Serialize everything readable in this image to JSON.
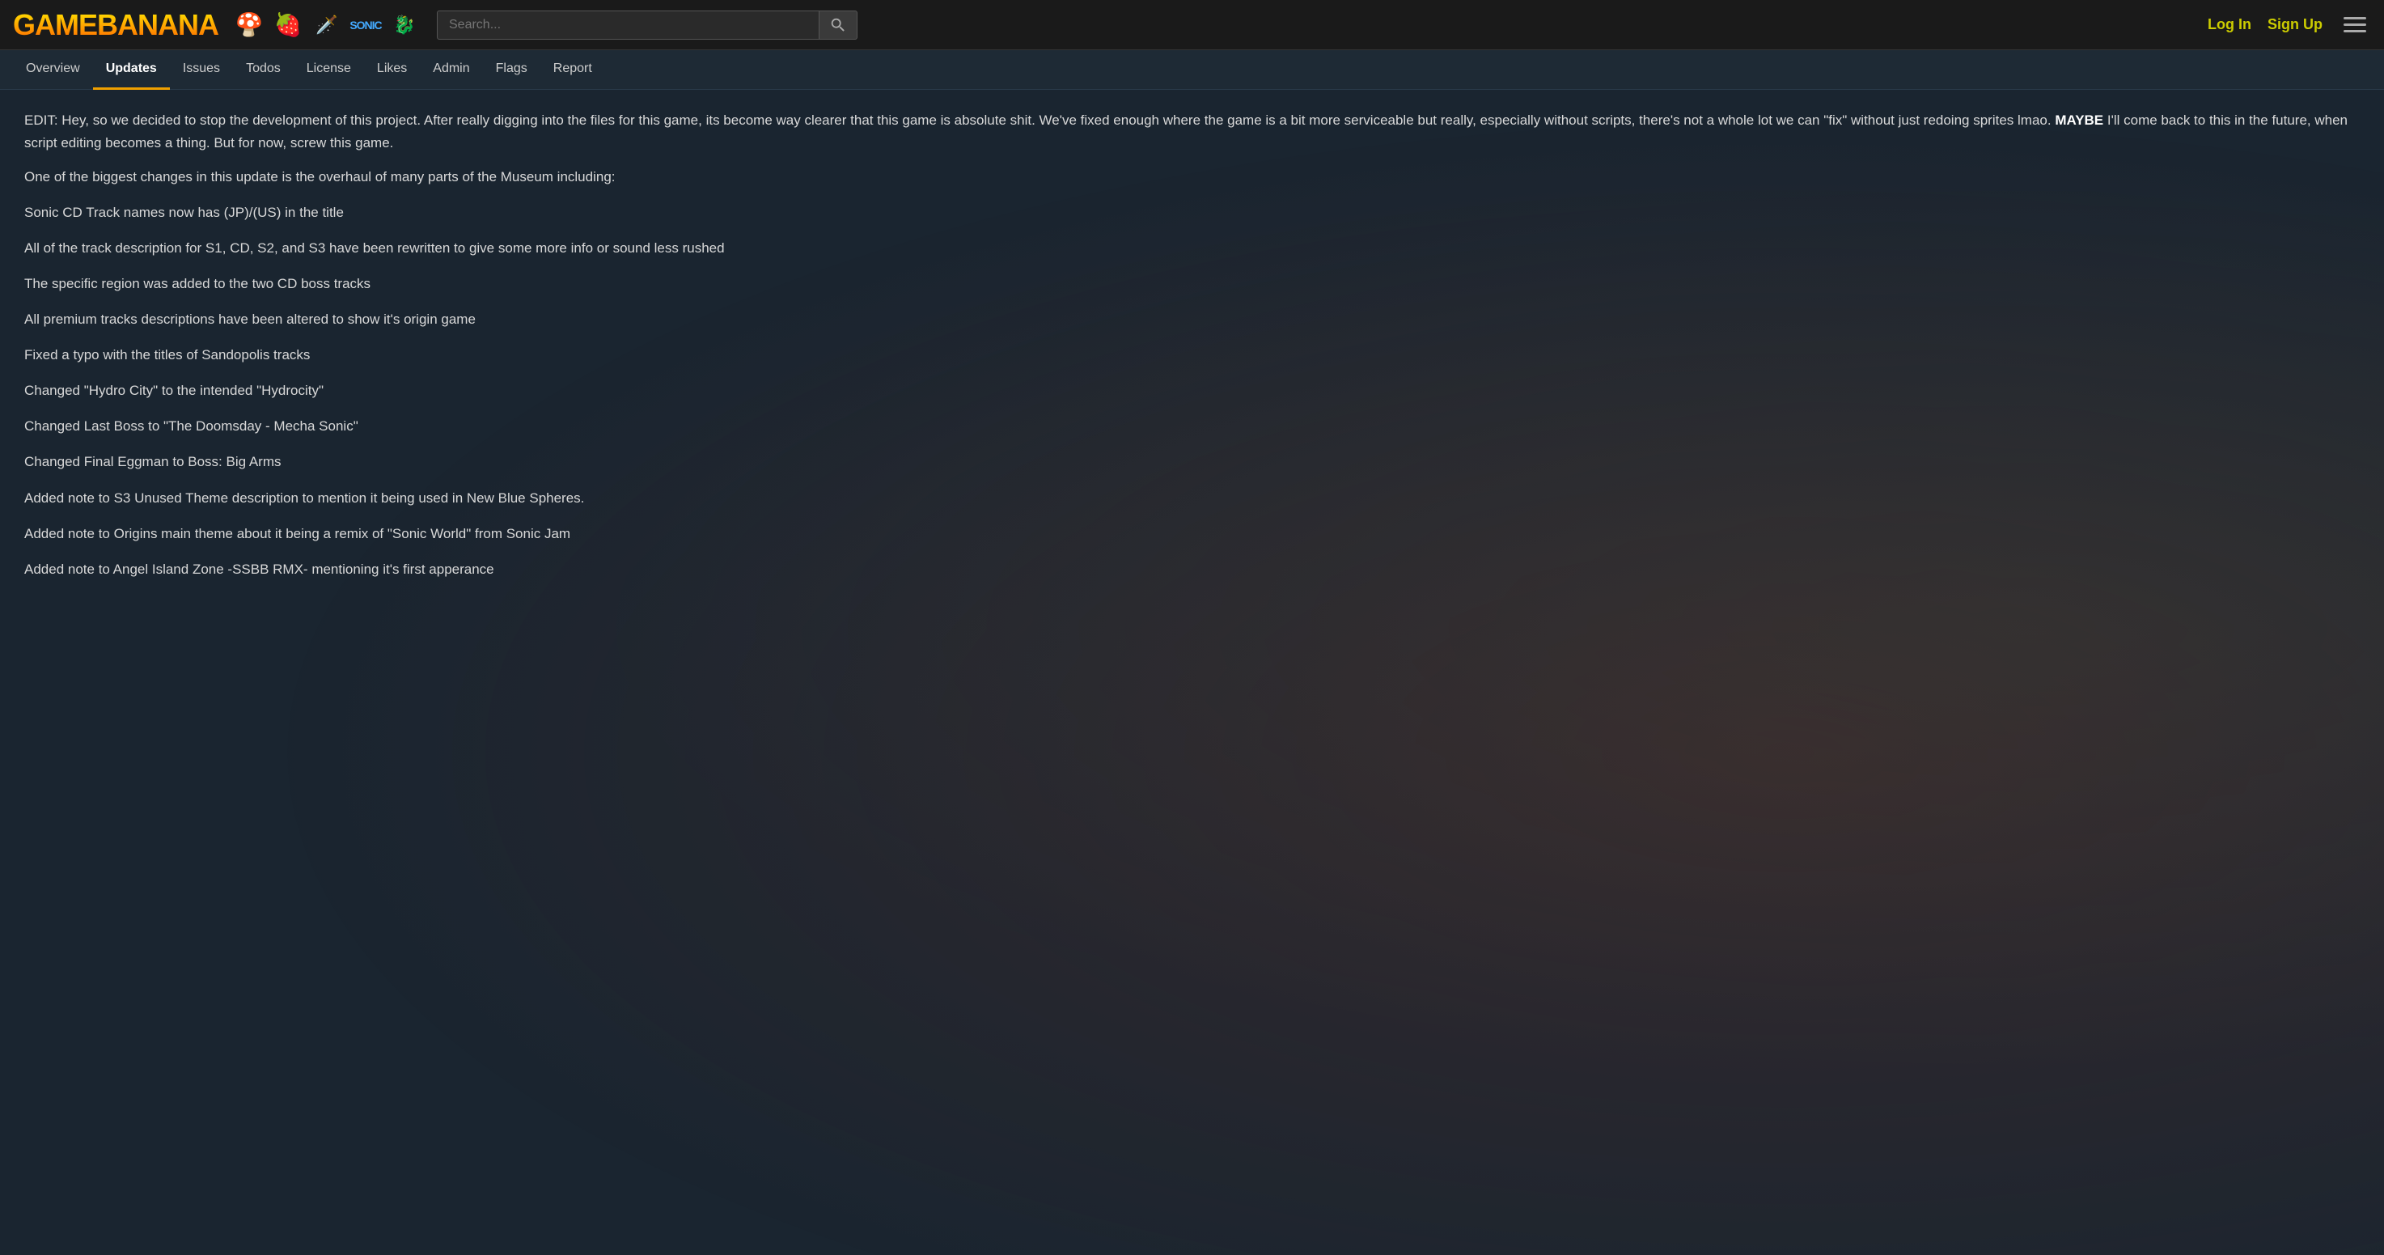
{
  "header": {
    "logo_text": "GAMEBANANA",
    "search_placeholder": "Search...",
    "login_label": "Log In",
    "signup_label": "Sign Up"
  },
  "nav": {
    "tabs": [
      {
        "id": "overview",
        "label": "Overview",
        "active": false
      },
      {
        "id": "updates",
        "label": "Updates",
        "active": true
      },
      {
        "id": "issues",
        "label": "Issues",
        "active": false
      },
      {
        "id": "todos",
        "label": "Todos",
        "active": false
      },
      {
        "id": "license",
        "label": "License",
        "active": false
      },
      {
        "id": "likes",
        "label": "Likes",
        "active": false
      },
      {
        "id": "admin",
        "label": "Admin",
        "active": false
      },
      {
        "id": "flags",
        "label": "Flags",
        "active": false
      },
      {
        "id": "report",
        "label": "Report",
        "active": false
      }
    ]
  },
  "content": {
    "edit_paragraph": "EDIT: Hey, so we decided to stop the development of this project. After really digging into the files for this game, its become way clearer that this game is absolute shit. We've fixed enough where the game is a bit more serviceable but really, especially without scripts, there's not a whole lot we can \"fix\" without just redoing sprites lmao.",
    "edit_bold": "MAYBE",
    "edit_continuation": " I'll come back to this in the future, when script editing becomes a thing. But for now, screw this game.",
    "lines": [
      "One of the biggest changes in this update is the overhaul of many parts of the Museum including:",
      "Sonic CD Track names now has (JP)/(US) in the title",
      "All of the track description for S1, CD, S2, and S3 have been rewritten to give some more info or sound less rushed",
      "The specific region was added to the two CD boss tracks",
      "All premium tracks descriptions have been altered to show it's origin game",
      "Fixed a typo with the titles of Sandopolis tracks",
      "Changed \"Hydro City\" to the intended \"Hydrocity\"",
      "Changed Last Boss to \"The Doomsday - Mecha Sonic\"",
      "Changed Final Eggman to Boss: Big Arms",
      "Added note to S3 Unused Theme description to mention it being used in New Blue Spheres.",
      "Added note to Origins main theme about it being a remix of \"Sonic World\" from Sonic Jam",
      "Added note to Angel Island Zone -SSBB RMX- mentioning it's first apperance"
    ]
  }
}
